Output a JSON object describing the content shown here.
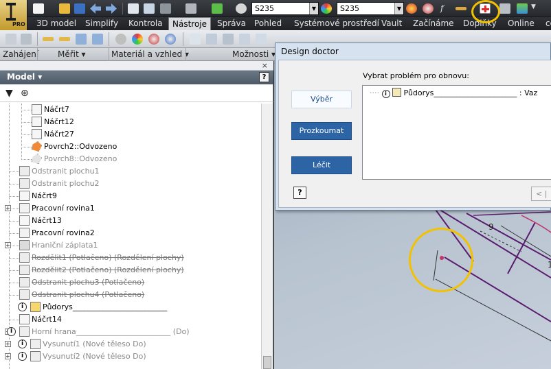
{
  "app": {
    "badge": "PRO"
  },
  "quick_access": {
    "material_combo": "S235",
    "appearance_combo": "S235"
  },
  "ribbon_tabs": [
    "3D model",
    "Simplify",
    "Kontrola",
    "Nástroje",
    "Správa",
    "Pohled",
    "Systémové prostředí",
    "Vault",
    "Začínáme",
    "Doplňky",
    "Online",
    "co"
  ],
  "active_tab": "Nástroje",
  "panels": [
    {
      "label": "Zahájení"
    },
    {
      "label": "Měřit ▾"
    },
    {
      "label": "Materiál a vzhled ▾"
    },
    {
      "label": "Možnosti ▾"
    }
  ],
  "browser": {
    "close": "×",
    "title": "Model ▾",
    "help": "?",
    "filter_icon": "filter-icon",
    "find_icon": "binoculars-icon",
    "tree": [
      {
        "label": "Náčrt7",
        "style": "normal"
      },
      {
        "label": "Náčrt12",
        "style": "normal"
      },
      {
        "label": "Náčrt27",
        "style": "normal"
      },
      {
        "label": "Povrch2::Odvozeno",
        "style": "normal"
      },
      {
        "label": "Povrch8::Odvozeno",
        "style": "grey"
      },
      {
        "label": "Odstranit plochu1",
        "style": "grey"
      },
      {
        "label": "Odstranit plochu2",
        "style": "grey"
      },
      {
        "label": "Náčrt9",
        "style": "normal"
      },
      {
        "label": "Pracovní rovina1",
        "style": "normal"
      },
      {
        "label": "Náčrt13",
        "style": "normal"
      },
      {
        "label": "Pracovní rovina2",
        "style": "normal"
      },
      {
        "label": "Hraniční záplata1",
        "style": "grey"
      },
      {
        "label": "Rozdělit1 (Potlačeno) (Rozdělení plochy)",
        "style": "strike"
      },
      {
        "label": "Rozdělit2 (Potlačeno) (Rozdělení plochy)",
        "style": "strike"
      },
      {
        "label": "Odstranit plochu3 (Potlačeno)",
        "style": "strike"
      },
      {
        "label": "Odstranit plochu4 (Potlačeno)",
        "style": "strike"
      },
      {
        "label": "Půdorys_________________________",
        "style": "normal"
      },
      {
        "label": "Náčrt14",
        "style": "normal"
      },
      {
        "label": "Horní hrana_________________________ (Do)",
        "style": "grey"
      },
      {
        "label": "Vysunutí1 (Nové těleso Do)",
        "style": "grey"
      },
      {
        "label": "Vysunutí2 (Nové těleso Do)",
        "style": "grey"
      }
    ]
  },
  "dialog": {
    "title": "Design doctor",
    "select_label": "Výběr",
    "examine_label": "Prozkoumat",
    "fix_label": "Léčit",
    "help": "?",
    "problem_label": "Vybrat problém pro obnovu:",
    "problem_item": "Půdorys______________________ : Vaz",
    "back_label": "< |"
  },
  "canvas": {
    "dimension_9": "9",
    "dimension_1": "1"
  },
  "colors": {
    "highlight": "#f2c200",
    "dialog_button": "#2d64a6",
    "canvas_line": "#5a1d6e"
  }
}
